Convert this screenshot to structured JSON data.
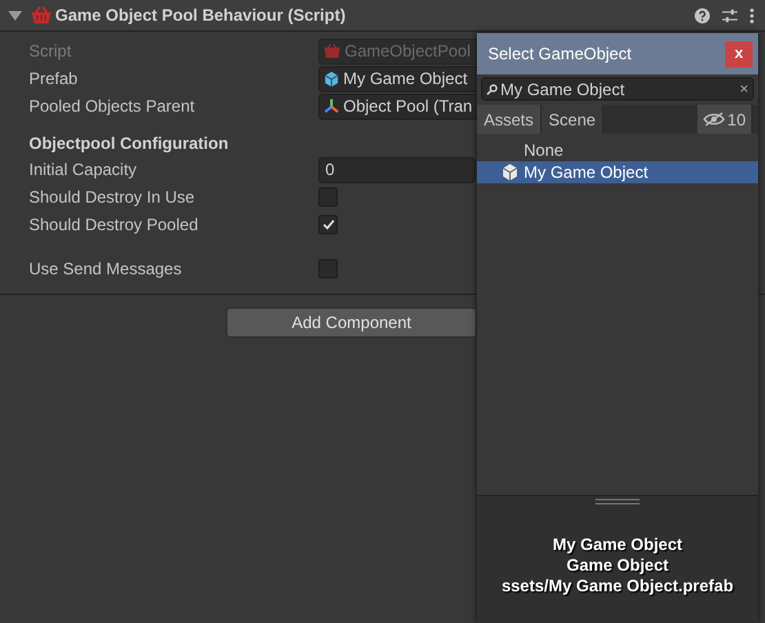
{
  "component": {
    "title": "Game Object Pool Behaviour (Script)",
    "expanded": true
  },
  "fields": [
    {
      "label": "Script",
      "value": "GameObjectPool",
      "disabled": true,
      "kind": "script"
    },
    {
      "label": "Prefab",
      "value": "My Game Object",
      "disabled": false,
      "kind": "prefab"
    },
    {
      "label": "Pooled Objects Parent",
      "value": "Object Pool (Tran",
      "disabled": false,
      "kind": "transform"
    }
  ],
  "section_heading": "Objectpool Configuration",
  "config": [
    {
      "kind": "number",
      "label": "Initial Capacity",
      "value": "0"
    },
    {
      "kind": "toggle",
      "label": "Should Destroy In Use",
      "checked": false
    },
    {
      "kind": "toggle",
      "label": "Should Destroy Pooled",
      "checked": true
    }
  ],
  "extra": [
    {
      "kind": "toggle",
      "label": "Use Send Messages",
      "checked": false
    }
  ],
  "add_button": "Add Component",
  "picker": {
    "title": "Select GameObject",
    "close": "x",
    "search": "My Game Object",
    "clear": "×",
    "tabs": [
      {
        "label": "Assets",
        "selected": true
      },
      {
        "label": "Scene",
        "selected": false
      }
    ],
    "hidden_count": "10",
    "items": [
      {
        "label": "None",
        "selected": false,
        "icon": false
      },
      {
        "label": "My Game Object",
        "selected": true,
        "icon": true
      }
    ],
    "preview": [
      "My Game Object",
      "Game Object",
      "ssets/My Game Object.prefab"
    ]
  }
}
